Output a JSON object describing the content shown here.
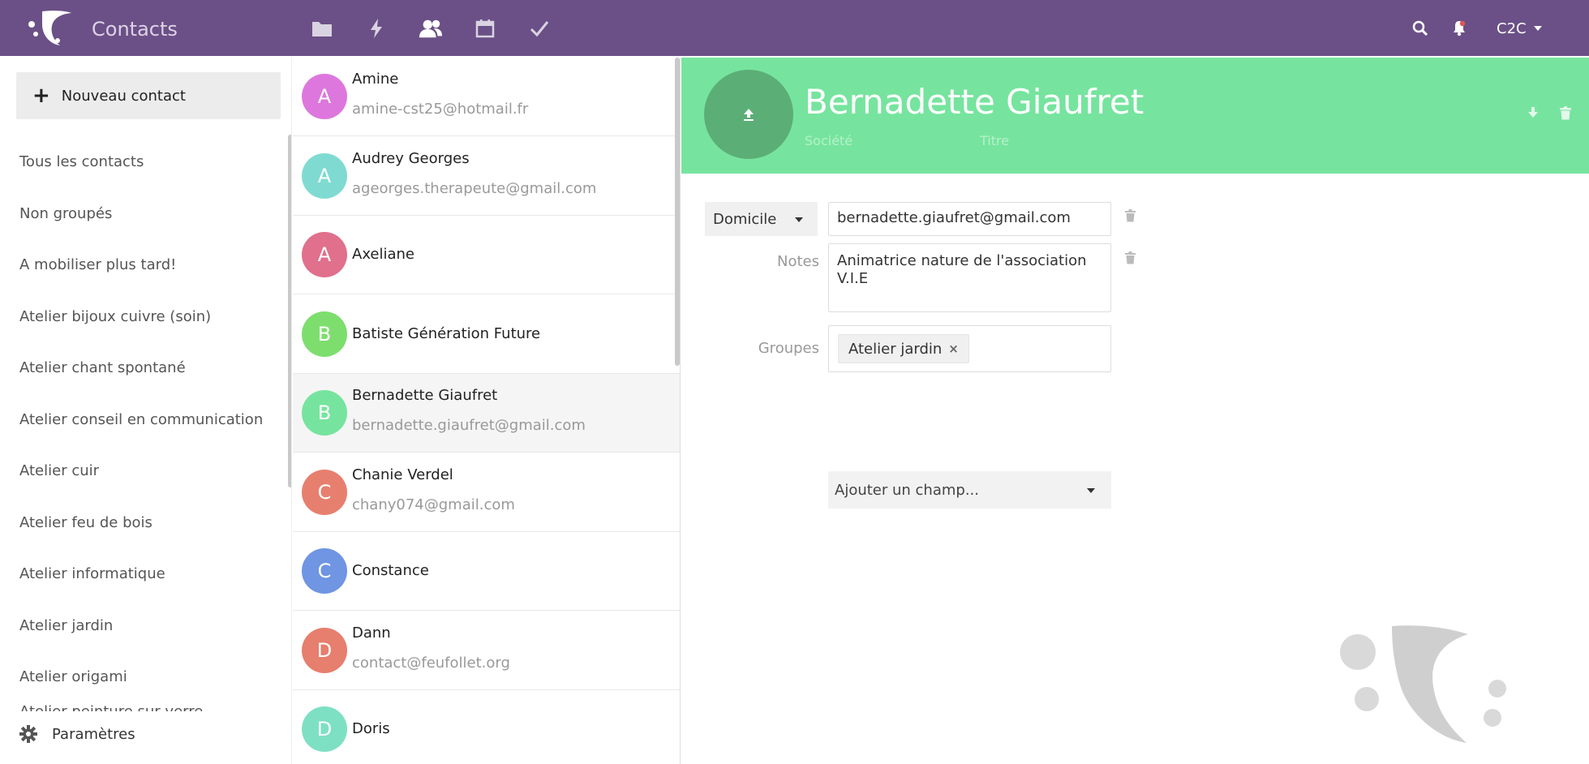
{
  "header": {
    "app_title": "Contacts",
    "nav_icons": [
      "folder-icon",
      "activity-icon",
      "contacts-icon",
      "calendar-icon",
      "tasks-icon"
    ],
    "active_nav": "contacts-icon",
    "user_label": "C2C",
    "brand_color": "#6b5087"
  },
  "sidebar": {
    "new_contact_label": "Nouveau contact",
    "groups": [
      {
        "label": "Tous les contacts"
      },
      {
        "label": "Non groupés"
      },
      {
        "label": "A mobiliser plus tard!"
      },
      {
        "label": "Atelier bijoux cuivre (soin)"
      },
      {
        "label": "Atelier chant spontané"
      },
      {
        "label": "Atelier conseil en communication"
      },
      {
        "label": "Atelier cuir"
      },
      {
        "label": "Atelier feu de bois"
      },
      {
        "label": "Atelier informatique"
      },
      {
        "label": "Atelier jardin"
      },
      {
        "label": "Atelier origami"
      }
    ],
    "partial_item": "Atelier peinture sur verre",
    "settings_label": "Paramètres"
  },
  "contacts": [
    {
      "initial": "A",
      "name": "Amine",
      "email": "amine-cst25@hotmail.fr",
      "color": "#dd77dd"
    },
    {
      "initial": "A",
      "name": "Audrey Georges",
      "email": "ageorges.therapeute@gmail.com",
      "color": "#7fdbd2"
    },
    {
      "initial": "A",
      "name": "Axeliane",
      "email": "",
      "color": "#e0708c"
    },
    {
      "initial": "B",
      "name": "Batiste Génération Future",
      "email": "",
      "color": "#7dde6e"
    },
    {
      "initial": "B",
      "name": "Bernadette Giaufret",
      "email": "bernadette.giaufret@gmail.com",
      "color": "#76e49e",
      "selected": true
    },
    {
      "initial": "C",
      "name": "Chanie Verdel",
      "email": "chany074@gmail.com",
      "color": "#e77f6f"
    },
    {
      "initial": "C",
      "name": "Constance",
      "email": "",
      "color": "#6f95e3"
    },
    {
      "initial": "D",
      "name": "Dann",
      "email": "contact@feufollet.org",
      "color": "#e67f6d"
    },
    {
      "initial": "D",
      "name": "Doris",
      "email": "",
      "color": "#7ee0c3"
    }
  ],
  "detail": {
    "full_name": "Bernadette Giaufret",
    "org_placeholder": "Société",
    "title_placeholder": "Titre",
    "header_color": "#76e49e",
    "email_type": "Domicile",
    "email_value": "bernadette.giaufret@gmail.com",
    "notes_label": "Notes",
    "notes_value": "Animatrice nature de l'association V.I.E",
    "groups_label": "Groupes",
    "group_tag": "Atelier jardin",
    "group_tag_remove": "×",
    "add_field_label": "Ajouter un champ..."
  }
}
